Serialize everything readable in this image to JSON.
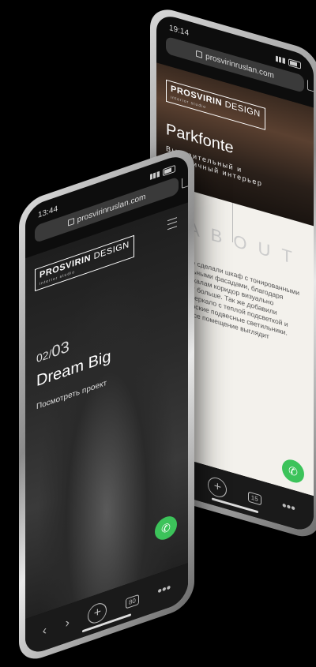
{
  "front_phone": {
    "time": "13:44",
    "url": "prosvirinruslan.com",
    "logo_main": "PROSVIRIN",
    "logo_second": "DESIGN",
    "logo_tag": "interior studio",
    "counter_current": "02",
    "counter_total": "03",
    "project_title": "Dream Big",
    "project_link": "Посмотреть проект",
    "tab_count": "80"
  },
  "back_phone": {
    "time": "19:14",
    "url": "prosvirinruslan.com",
    "logo_main": "PROSVIRIN",
    "logo_second": "DESIGN",
    "logo_tag": "interior studio",
    "project_title": "Parkfonte",
    "project_sub": "Выразительный и динамичный интерьер",
    "about_label": "ABOUT",
    "body_text": "коридоре сделали шкаф с тонированными и зеркальными фасадами, благодаря этим зеркалам коридор визуально выглядит больше. Так же добавили круглое зеркало с теплой подсветкой и дизайнерские подвесные светильники. Теперь все помещение выглядит",
    "tab_count": "15"
  },
  "colors": {
    "call_button": "#3cc35a",
    "page_bg": "#000000"
  }
}
